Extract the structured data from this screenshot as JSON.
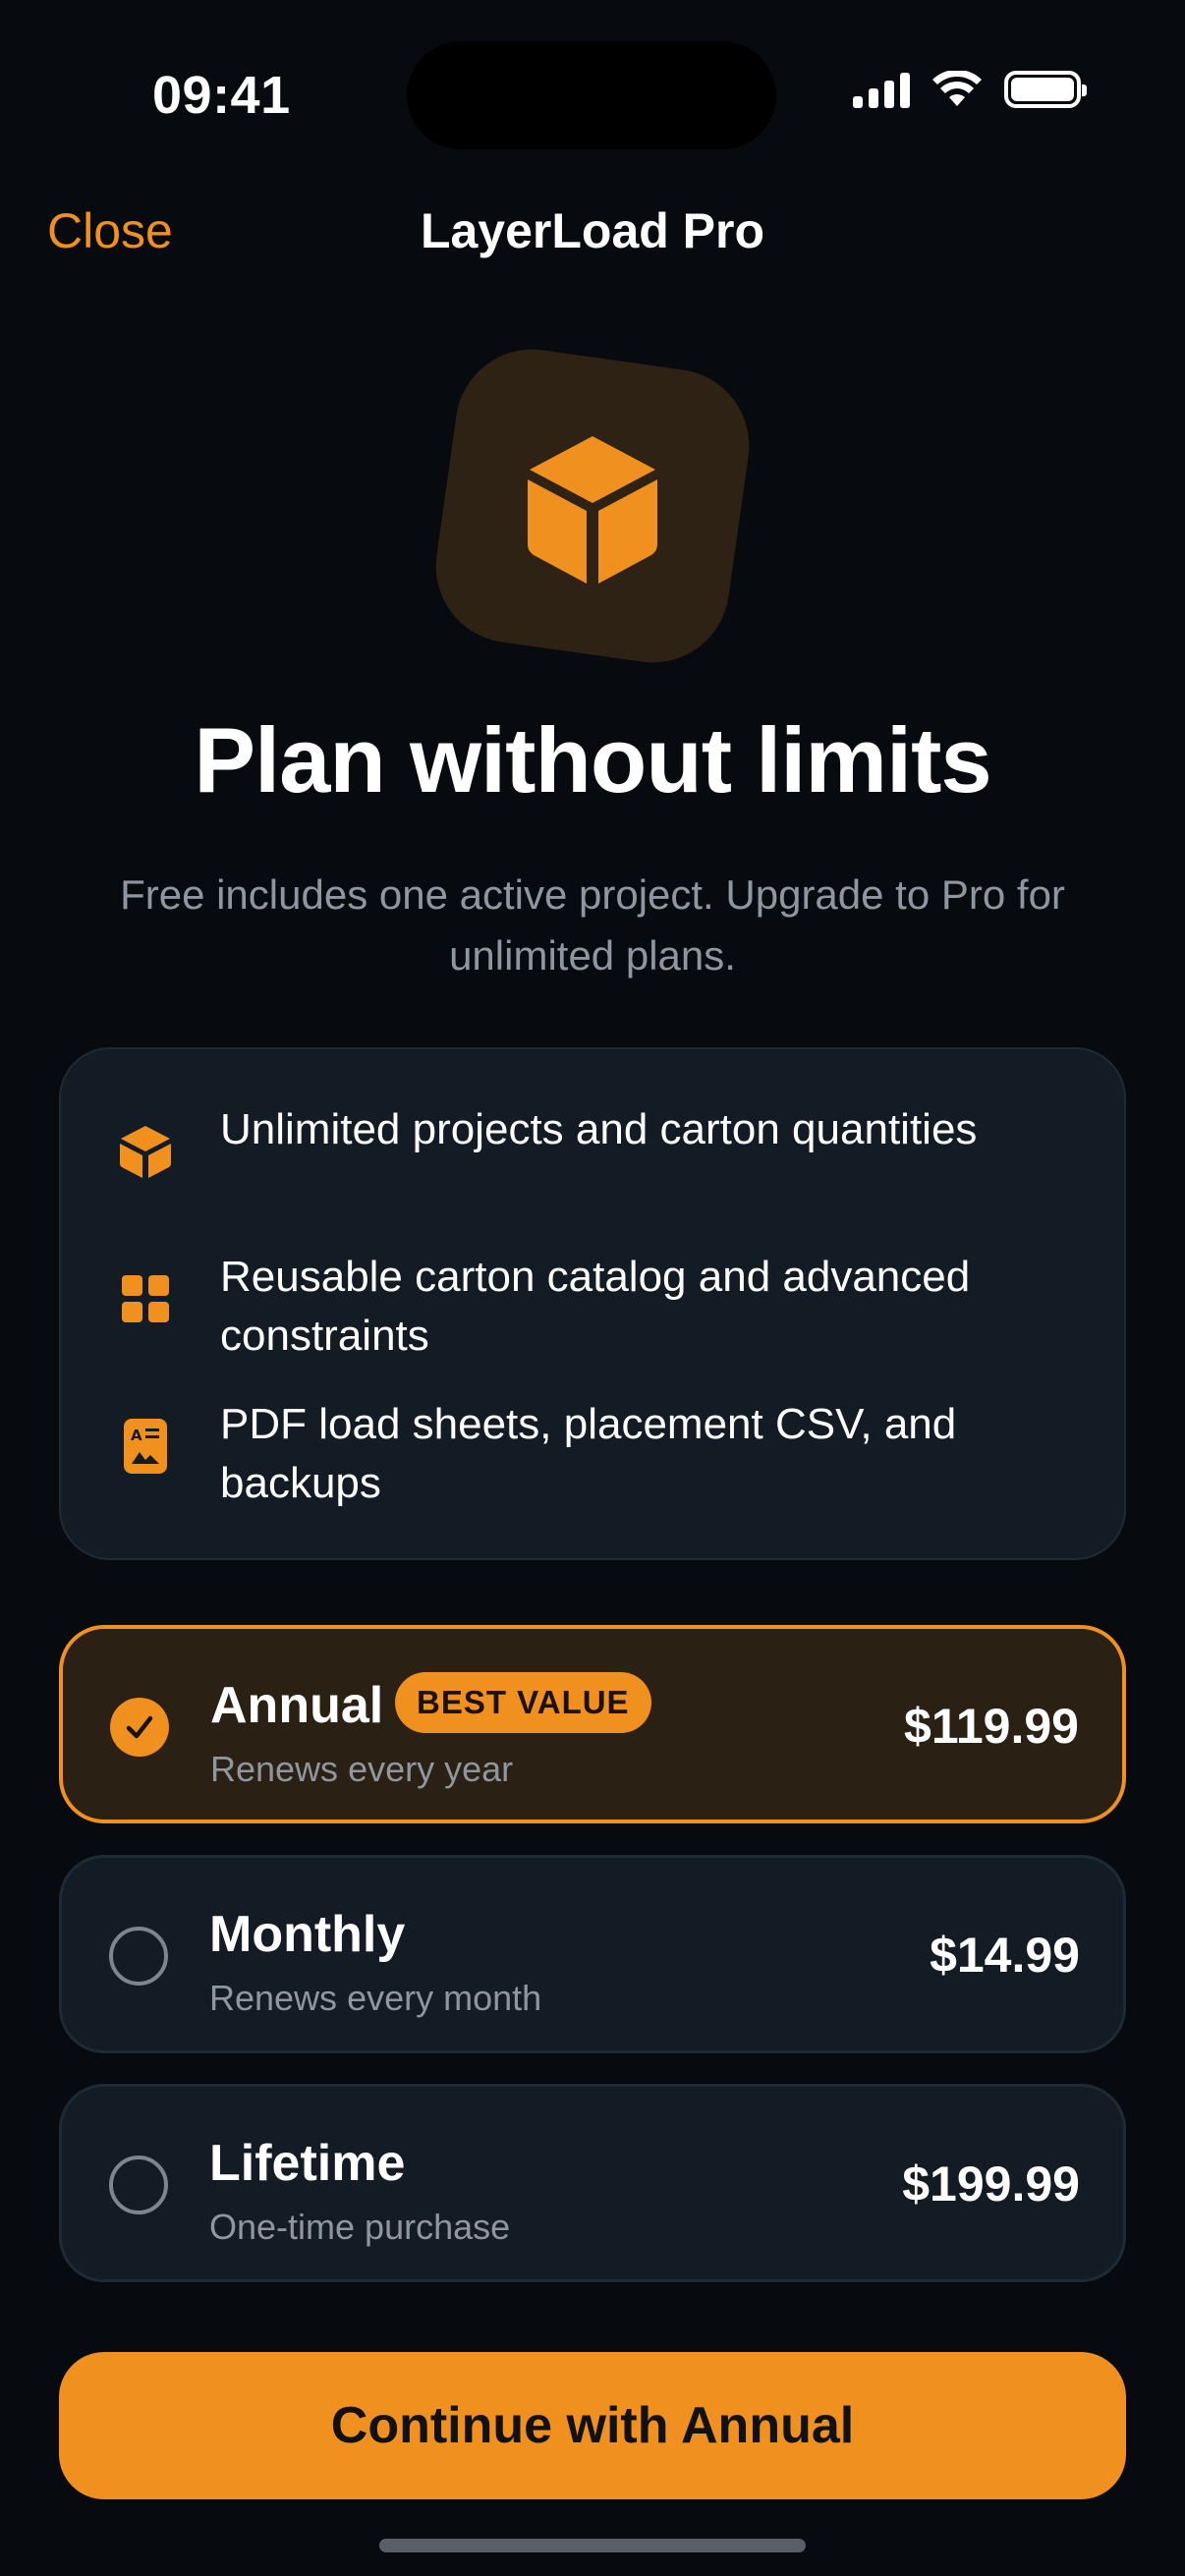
{
  "status_bar": {
    "time": "09:41"
  },
  "nav": {
    "close_label": "Close",
    "title": "LayerLoad Pro"
  },
  "hero": {
    "headline": "Plan without limits",
    "subtitle": "Free includes one active project. Upgrade to Pro for unlimited plans."
  },
  "features": [
    {
      "icon": "cube-icon",
      "text": "Unlimited projects and carton quantities"
    },
    {
      "icon": "grid-icon",
      "text": "Reusable carton catalog and advanced constraints"
    },
    {
      "icon": "document-icon",
      "text": "PDF load sheets, placement CSV, and backups"
    }
  ],
  "plans": [
    {
      "name": "Annual",
      "badge": "BEST VALUE",
      "description": "Renews every year",
      "price": "$119.99",
      "selected": true
    },
    {
      "name": "Monthly",
      "description": "Renews every month",
      "price": "$14.99",
      "selected": false
    },
    {
      "name": "Lifetime",
      "description": "One-time purchase",
      "price": "$199.99",
      "selected": false
    }
  ],
  "cta": {
    "label": "Continue with Annual"
  },
  "colors": {
    "accent": "#f0901e",
    "background": "#070b10",
    "card": "#131c24",
    "selected_card": "#2a2014",
    "muted_text": "#8f969f"
  }
}
